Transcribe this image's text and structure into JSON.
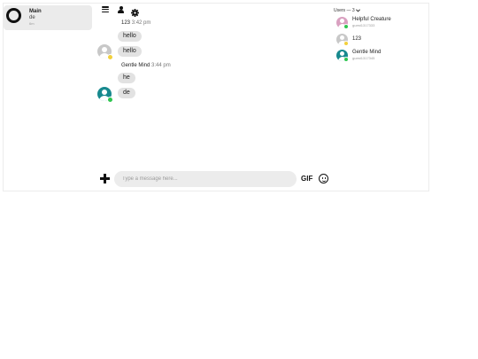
{
  "sidebar": {
    "room": {
      "name": "Main",
      "last_message": "de",
      "time": "6m"
    }
  },
  "toolbar": {
    "icons": [
      "menu-icon",
      "user-icon",
      "settings-icon"
    ]
  },
  "messages": [
    {
      "author": "123",
      "time": "3:42 pm",
      "bubbles": [
        "hello",
        "hello"
      ],
      "avatar_color": "#c8c8c8",
      "status_color": "#f2d03c"
    },
    {
      "author": "Gentle Mind",
      "time": "3:44 pm",
      "bubbles": [
        "he",
        "de"
      ],
      "avatar_color": "#17898e",
      "status_color": "#2ec54f"
    }
  ],
  "users_panel": {
    "label": "Users — 3",
    "users": [
      {
        "name": "Helpful Creature",
        "sub": "guest1317333",
        "avatar_color": "#d9a0c0",
        "status_color": "#2ec54f"
      },
      {
        "name": "123",
        "sub": "",
        "avatar_color": "#c8c8c8",
        "status_color": "#f2d03c"
      },
      {
        "name": "Gentle Mind",
        "sub": "guest1317345",
        "avatar_color": "#17898e",
        "status_color": "#2ec54f"
      }
    ]
  },
  "composer": {
    "placeholder": "Type a message here...",
    "gif_label": "GIF"
  }
}
